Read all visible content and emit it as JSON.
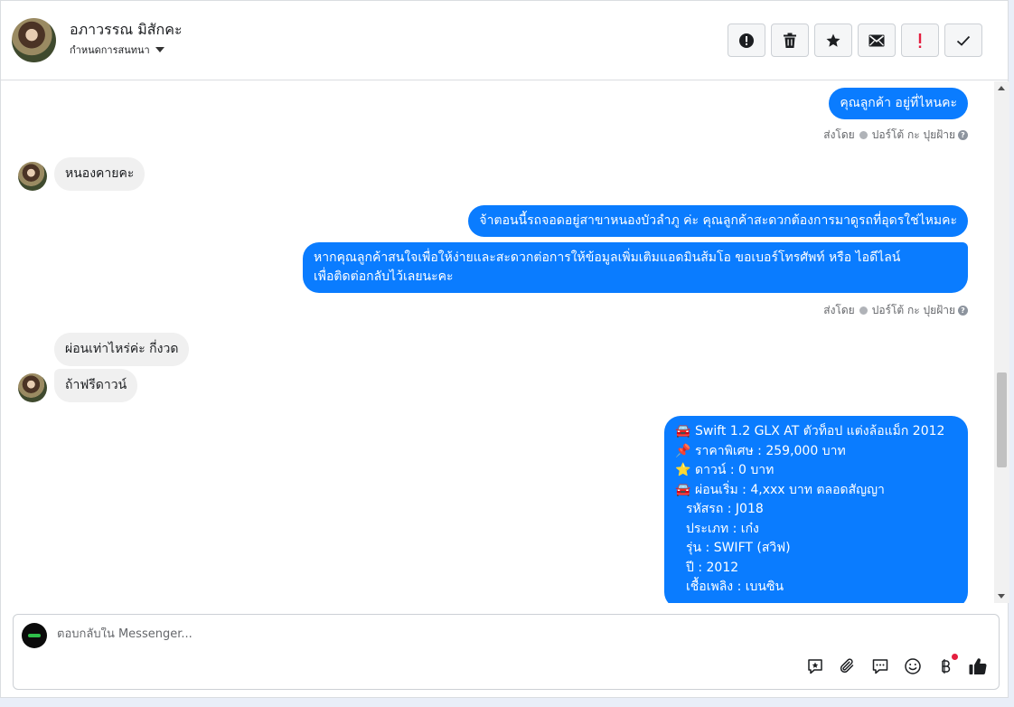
{
  "header": {
    "contact_name": "อภาวรรณ มิสักคะ",
    "assign_label": "กำหนดการสนทนา",
    "actions": [
      {
        "name": "mark-spam-button",
        "icon": "alert-circle-icon"
      },
      {
        "name": "delete-button",
        "icon": "trash-icon"
      },
      {
        "name": "star-button",
        "icon": "star-icon"
      },
      {
        "name": "mark-unread-button",
        "icon": "envelope-icon"
      },
      {
        "name": "follow-up-button",
        "icon": "exclamation-icon"
      },
      {
        "name": "mark-done-button",
        "icon": "check-icon"
      }
    ]
  },
  "messages": {
    "m1": "คุณลูกค้า อยู่ที่ไหนคะ",
    "sent1_prefix": "ส่งโดย",
    "sent1_name": "ปอร์โต้ กะ ปุยฝ้าย",
    "m2": "หนองคายคะ",
    "m3": "จ้าตอนนี้รถจอดอยู่สาขาหนองบัวลำภู ค่ะ คุณลูกค้าสะดวกต้องการมาดูรถที่อุดรใช่ไหมคะ",
    "m4_line1": "หากคุณลูกค้าสนใจเพื่อให้ง่ายและสะดวกต่อการให้ข้อมูลเพิ่มเติมแอดมินส้มโอ ขอเบอร์โทรศัพท์ หรือ ไอดีไลน์",
    "m4_line2": "เพื่อติดต่อกลับไว้เลยนะคะ",
    "sent2_prefix": "ส่งโดย",
    "sent2_name": "ปอร์โต้ กะ ปุยฝ้าย",
    "m5": "ผ่อนเท่าไหร่ค่ะ กี่งวด",
    "m6": "ถ้าฟรีดาวน์",
    "card": {
      "line1_emoji": "🚘",
      "line1": "Swift 1.2 GLX AT ตัวท็อป แต่งล้อแม็ก 2012",
      "line2_emoji": "📌",
      "line2": "ราคาพิเศษ : 259,000 บาท",
      "line3_emoji": "⭐",
      "line3": "ดาวน์ : 0 บาท",
      "line4_emoji": "🚘",
      "line4": "ผ่อนเริ่ม : 4,xxx บาท ตลอดสัญญา",
      "line5": "รหัสรถ : J018",
      "line6": "ประเภท : เก๋ง",
      "line7": "รุ่น : SWIFT (สวิฟ)",
      "line8": "ปี : 2012",
      "line9": "เชื้อเพลิง : เบนซิน"
    }
  },
  "composer": {
    "placeholder": "ตอบกลับใน Messenger...",
    "tools": [
      "saved-reply-icon",
      "attachment-icon",
      "chat-bubble-icon",
      "emoji-icon",
      "baht-icon",
      "like-icon"
    ]
  },
  "colors": {
    "outgoing_bubble": "#0a7cff",
    "incoming_bubble": "#f0f0f0",
    "notification_dot": "#e41e3f"
  }
}
